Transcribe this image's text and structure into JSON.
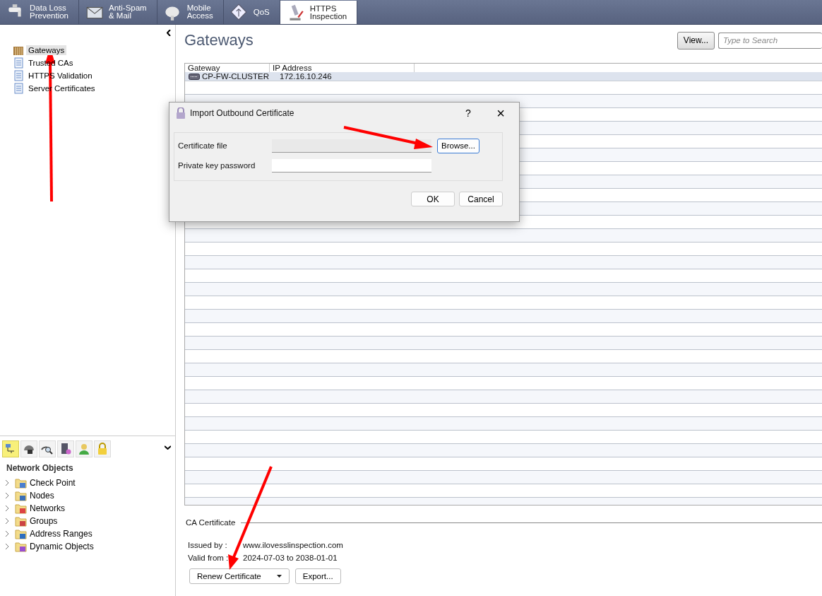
{
  "tabs": [
    {
      "label": "Data Loss\nPrevention",
      "selected": false
    },
    {
      "label": "Anti-Spam\n& Mail",
      "selected": false
    },
    {
      "label": "Mobile\nAccess",
      "selected": false
    },
    {
      "label": "QoS",
      "selected": false
    },
    {
      "label": "HTTPS\nInspection",
      "selected": true
    }
  ],
  "sidebar": {
    "items": [
      {
        "label": "Gateways",
        "selected": true
      },
      {
        "label": "Trusted CAs",
        "selected": false
      },
      {
        "label": "HTTPS Validation",
        "selected": false
      },
      {
        "label": "Server Certificates",
        "selected": false
      }
    ]
  },
  "object_toolbar": [
    {
      "selected": true
    },
    {
      "selected": false
    },
    {
      "selected": false
    },
    {
      "selected": false
    },
    {
      "selected": false
    },
    {
      "selected": false
    }
  ],
  "network_objects": {
    "title": "Network Objects",
    "items": [
      {
        "label": "Check Point",
        "expanded": false
      },
      {
        "label": "Nodes",
        "expanded": false
      },
      {
        "label": "Networks",
        "expanded": false
      },
      {
        "label": "Groups",
        "expanded": false
      },
      {
        "label": "Address Ranges",
        "expanded": false
      },
      {
        "label": "Dynamic Objects",
        "expanded": false
      }
    ]
  },
  "main": {
    "title": "Gateways",
    "view_button": "View...",
    "search": {
      "placeholder": "Type to Search"
    }
  },
  "table": {
    "columns": [
      "Gateway",
      "IP Address"
    ],
    "rows": [
      {
        "cells": [
          "CP-FW-CLUSTER",
          "172.16.10.246"
        ],
        "selected": true
      }
    ]
  },
  "ca_certificate": {
    "title": "CA Certificate",
    "issued_by_label": "Issued by :",
    "issued_by": "www.ilovesslinspection.com",
    "valid_from_label": "Valid from :",
    "valid_from": "2024-07-03 to 2038-01-01",
    "renew_button": "Renew Certificate",
    "export_button": "Export..."
  },
  "dialog": {
    "title": "Import Outbound Certificate",
    "help": "?",
    "close": "×",
    "fields": [
      {
        "label": "Certificate file",
        "disabled": true
      },
      {
        "label": "Private key password",
        "disabled": false
      }
    ],
    "browse_button": "Browse...",
    "ok_button": "OK",
    "cancel_button": "Cancel"
  }
}
